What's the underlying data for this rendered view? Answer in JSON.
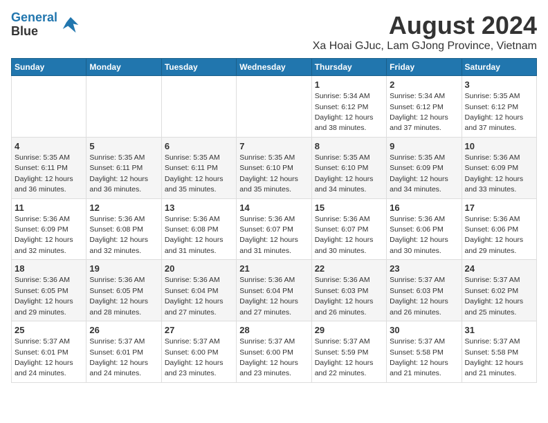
{
  "header": {
    "logo_line1": "General",
    "logo_line2": "Blue",
    "title": "August 2024",
    "subtitle": "Xa Hoai GJuc, Lam GJong Province, Vietnam"
  },
  "weekdays": [
    "Sunday",
    "Monday",
    "Tuesday",
    "Wednesday",
    "Thursday",
    "Friday",
    "Saturday"
  ],
  "weeks": [
    [
      {
        "day": "",
        "content": ""
      },
      {
        "day": "",
        "content": ""
      },
      {
        "day": "",
        "content": ""
      },
      {
        "day": "",
        "content": ""
      },
      {
        "day": "1",
        "content": "Sunrise: 5:34 AM\nSunset: 6:12 PM\nDaylight: 12 hours\nand 38 minutes."
      },
      {
        "day": "2",
        "content": "Sunrise: 5:34 AM\nSunset: 6:12 PM\nDaylight: 12 hours\nand 37 minutes."
      },
      {
        "day": "3",
        "content": "Sunrise: 5:35 AM\nSunset: 6:12 PM\nDaylight: 12 hours\nand 37 minutes."
      }
    ],
    [
      {
        "day": "4",
        "content": "Sunrise: 5:35 AM\nSunset: 6:11 PM\nDaylight: 12 hours\nand 36 minutes."
      },
      {
        "day": "5",
        "content": "Sunrise: 5:35 AM\nSunset: 6:11 PM\nDaylight: 12 hours\nand 36 minutes."
      },
      {
        "day": "6",
        "content": "Sunrise: 5:35 AM\nSunset: 6:11 PM\nDaylight: 12 hours\nand 35 minutes."
      },
      {
        "day": "7",
        "content": "Sunrise: 5:35 AM\nSunset: 6:10 PM\nDaylight: 12 hours\nand 35 minutes."
      },
      {
        "day": "8",
        "content": "Sunrise: 5:35 AM\nSunset: 6:10 PM\nDaylight: 12 hours\nand 34 minutes."
      },
      {
        "day": "9",
        "content": "Sunrise: 5:35 AM\nSunset: 6:09 PM\nDaylight: 12 hours\nand 34 minutes."
      },
      {
        "day": "10",
        "content": "Sunrise: 5:36 AM\nSunset: 6:09 PM\nDaylight: 12 hours\nand 33 minutes."
      }
    ],
    [
      {
        "day": "11",
        "content": "Sunrise: 5:36 AM\nSunset: 6:09 PM\nDaylight: 12 hours\nand 32 minutes."
      },
      {
        "day": "12",
        "content": "Sunrise: 5:36 AM\nSunset: 6:08 PM\nDaylight: 12 hours\nand 32 minutes."
      },
      {
        "day": "13",
        "content": "Sunrise: 5:36 AM\nSunset: 6:08 PM\nDaylight: 12 hours\nand 31 minutes."
      },
      {
        "day": "14",
        "content": "Sunrise: 5:36 AM\nSunset: 6:07 PM\nDaylight: 12 hours\nand 31 minutes."
      },
      {
        "day": "15",
        "content": "Sunrise: 5:36 AM\nSunset: 6:07 PM\nDaylight: 12 hours\nand 30 minutes."
      },
      {
        "day": "16",
        "content": "Sunrise: 5:36 AM\nSunset: 6:06 PM\nDaylight: 12 hours\nand 30 minutes."
      },
      {
        "day": "17",
        "content": "Sunrise: 5:36 AM\nSunset: 6:06 PM\nDaylight: 12 hours\nand 29 minutes."
      }
    ],
    [
      {
        "day": "18",
        "content": "Sunrise: 5:36 AM\nSunset: 6:05 PM\nDaylight: 12 hours\nand 29 minutes."
      },
      {
        "day": "19",
        "content": "Sunrise: 5:36 AM\nSunset: 6:05 PM\nDaylight: 12 hours\nand 28 minutes."
      },
      {
        "day": "20",
        "content": "Sunrise: 5:36 AM\nSunset: 6:04 PM\nDaylight: 12 hours\nand 27 minutes."
      },
      {
        "day": "21",
        "content": "Sunrise: 5:36 AM\nSunset: 6:04 PM\nDaylight: 12 hours\nand 27 minutes."
      },
      {
        "day": "22",
        "content": "Sunrise: 5:36 AM\nSunset: 6:03 PM\nDaylight: 12 hours\nand 26 minutes."
      },
      {
        "day": "23",
        "content": "Sunrise: 5:37 AM\nSunset: 6:03 PM\nDaylight: 12 hours\nand 26 minutes."
      },
      {
        "day": "24",
        "content": "Sunrise: 5:37 AM\nSunset: 6:02 PM\nDaylight: 12 hours\nand 25 minutes."
      }
    ],
    [
      {
        "day": "25",
        "content": "Sunrise: 5:37 AM\nSunset: 6:01 PM\nDaylight: 12 hours\nand 24 minutes."
      },
      {
        "day": "26",
        "content": "Sunrise: 5:37 AM\nSunset: 6:01 PM\nDaylight: 12 hours\nand 24 minutes."
      },
      {
        "day": "27",
        "content": "Sunrise: 5:37 AM\nSunset: 6:00 PM\nDaylight: 12 hours\nand 23 minutes."
      },
      {
        "day": "28",
        "content": "Sunrise: 5:37 AM\nSunset: 6:00 PM\nDaylight: 12 hours\nand 23 minutes."
      },
      {
        "day": "29",
        "content": "Sunrise: 5:37 AM\nSunset: 5:59 PM\nDaylight: 12 hours\nand 22 minutes."
      },
      {
        "day": "30",
        "content": "Sunrise: 5:37 AM\nSunset: 5:58 PM\nDaylight: 12 hours\nand 21 minutes."
      },
      {
        "day": "31",
        "content": "Sunrise: 5:37 AM\nSunset: 5:58 PM\nDaylight: 12 hours\nand 21 minutes."
      }
    ]
  ]
}
